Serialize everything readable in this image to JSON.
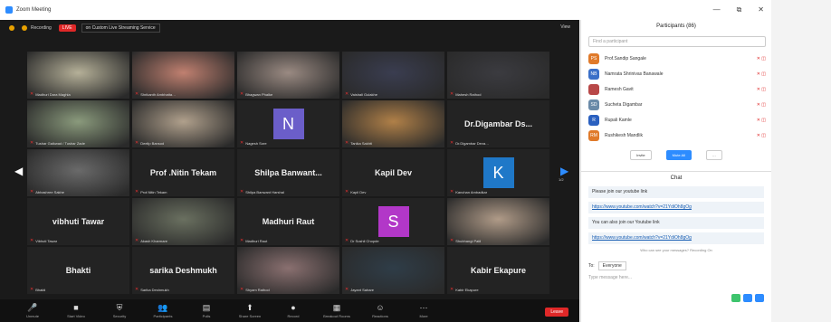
{
  "window": {
    "title": "Zoom Meeting",
    "controls": [
      "—",
      "⧉",
      "✕"
    ]
  },
  "topbar": {
    "recording_label": "Recording",
    "live_label": "LIVE",
    "stream_label": "on Custom Live Streaming Service",
    "view_label": "View"
  },
  "grid": {
    "page_left": "1/2",
    "page_right": "1/2",
    "tiles": [
      {
        "name": "Madhuri Dara Maghla",
        "kind": "photo",
        "color": "#b5b098",
        "active": true
      },
      {
        "name": "Shrikanth Ambhatta…",
        "kind": "photo",
        "color": "#c08070"
      },
      {
        "name": "Bhagwan Phalke",
        "kind": "photo",
        "color": "#9a8a82"
      },
      {
        "name": "Vaishali Gulakhe",
        "kind": "photo",
        "color": "#3a3d50"
      },
      {
        "name": "Mahesh Rathod",
        "kind": "photo",
        "color": "#3b3b40"
      },
      {
        "name": "Tushar Gaikwad / Tushar Zade",
        "kind": "photo",
        "color": "#8a9a7c"
      },
      {
        "name": "Deelip Bansod",
        "kind": "photo",
        "color": "#b0a08c"
      },
      {
        "name": "Nagesh Sore",
        "kind": "avatar",
        "letter": "N",
        "color": "#6b5ec9"
      },
      {
        "name": "Tanika Sakhti",
        "kind": "photo",
        "color": "#b08048"
      },
      {
        "name": "Dr.Digambar Deva…",
        "kind": "bigname",
        "label": "Dr.Digambar  Ds..."
      },
      {
        "name": "Abhashree Sakhe",
        "kind": "photo",
        "color": "#6a6a6a"
      },
      {
        "name": "Prof.Nitin Tekam",
        "kind": "bigname",
        "label": "Prof .Nitin Tekam"
      },
      {
        "name": "Shilpa Banwant Harshal",
        "kind": "bigname",
        "label": "Shilpa  Banwant..."
      },
      {
        "name": "Kapil Dev",
        "kind": "bigname",
        "label": "Kapil Dev"
      },
      {
        "name": "Kanchan Ambadkar",
        "kind": "avatar",
        "letter": "K",
        "color": "#1f78c8"
      },
      {
        "name": "Vibhuti Tawar",
        "kind": "bigname",
        "label": "vibhuti Tawar"
      },
      {
        "name": "Akash Kharmare",
        "kind": "photo",
        "color": "#6a7060"
      },
      {
        "name": "Madhuri Raut",
        "kind": "bigname",
        "label": "Madhuri Raut"
      },
      {
        "name": "Dr Sushil Chopde",
        "kind": "avatar",
        "letter": "S",
        "color": "#b237c8"
      },
      {
        "name": "Shubhangi Patil",
        "kind": "photo",
        "color": "#b09b88"
      },
      {
        "name": "Bhakti",
        "kind": "bigname",
        "label": "Bhakti"
      },
      {
        "name": "Sarika Deshmukh",
        "kind": "bigname",
        "label": "sarika Deshmukh"
      },
      {
        "name": "Shyam Rathod",
        "kind": "photo",
        "color": "#8a7070"
      },
      {
        "name": "Jayant Sahare",
        "kind": "photo",
        "color": "#2f3d48"
      },
      {
        "name": "Kabir Ekapure",
        "kind": "bigname",
        "label": "Kabir Ekapure"
      }
    ]
  },
  "toolbar": {
    "items": [
      {
        "icon": "🎤",
        "label": "Unmute"
      },
      {
        "icon": "■",
        "label": "Start Video"
      },
      {
        "icon": "⛨",
        "label": "Security"
      },
      {
        "icon": "👥",
        "label": "Participants"
      },
      {
        "icon": "▤",
        "label": "Polls"
      },
      {
        "icon": "⬆",
        "label": "Share Screen"
      },
      {
        "icon": "●",
        "label": "Record"
      },
      {
        "icon": "▦",
        "label": "Breakout Rooms"
      },
      {
        "icon": "☺",
        "label": "Reactions"
      },
      {
        "icon": "⋯",
        "label": "More"
      }
    ],
    "end_label": "Leave"
  },
  "participants": {
    "title": "Participants (86)",
    "search_placeholder": "Find a participant",
    "items": [
      {
        "initials": "PS",
        "name": "Prof.Sandip Sangale",
        "color": "#e07a2a"
      },
      {
        "initials": "NB",
        "name": "Namrata Shrinivas Banawale",
        "color": "#3a6fc8"
      },
      {
        "initials": "",
        "name": "Ramesh Gavit",
        "color": "#b84848"
      },
      {
        "initials": "SD",
        "name": "Sucheta Digambar",
        "color": "#6a8aa8"
      },
      {
        "initials": "R",
        "name": "Rupali Kamle",
        "color": "#2a60c0"
      },
      {
        "initials": "RM",
        "name": "Rushikesh Mandlik",
        "color": "#e07a2a"
      }
    ],
    "invite_label": "Invite",
    "mute_all_label": "Mute All",
    "more_label": "…"
  },
  "chat": {
    "title": "Chat",
    "messages": [
      {
        "text": "Please join our youtube link",
        "link": ""
      },
      {
        "text": "",
        "link": "https://www.youtube.com/watch?v=21YdiOh8gOg"
      },
      {
        "text": "You can also join our Youtube link",
        "link": ""
      },
      {
        "text": "",
        "link": "https://www.youtube.com/watch?v=21YdiOh8gOg"
      }
    ],
    "who_can_see": "Who can see your messages? Recording On",
    "to_label": "To:",
    "to_value": "Everyone",
    "type_placeholder": "Type message here..."
  }
}
